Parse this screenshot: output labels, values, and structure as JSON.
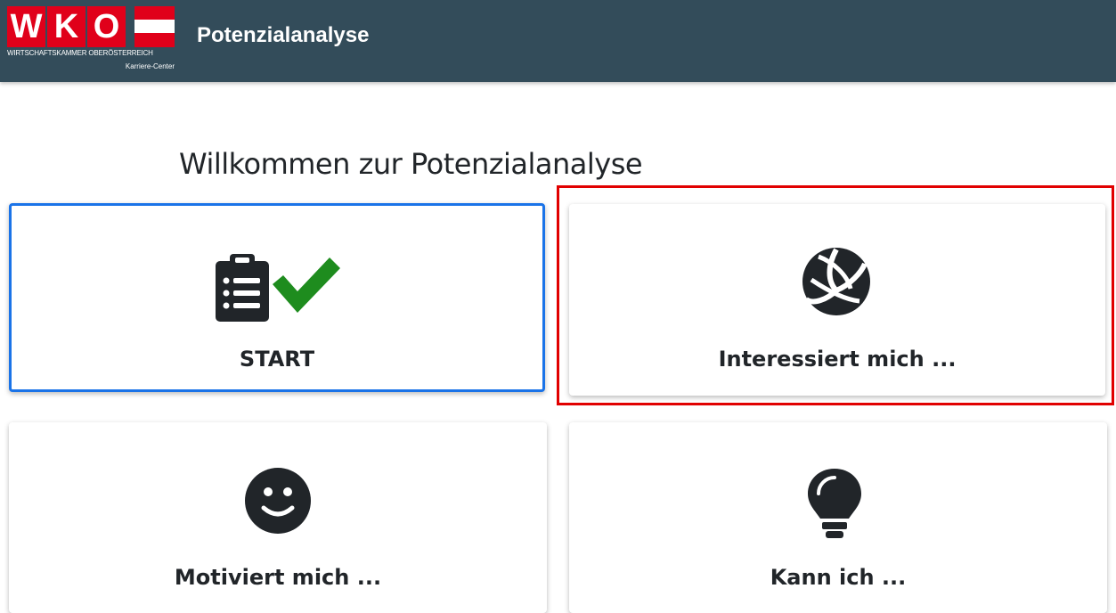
{
  "header": {
    "logo_letters": [
      "W",
      "K",
      "O"
    ],
    "logo_subtitle": "WIRTSCHAFTSKAMMER OBERÖSTERREICH",
    "logo_subtitle2": "Karriere-Center",
    "title": "Potenzialanalyse"
  },
  "main": {
    "heading": "Willkommen zur Potenzialanalyse",
    "tiles": [
      {
        "label": "START",
        "icon": "clipboard-check-icon"
      },
      {
        "label": "Interessiert mich ...",
        "icon": "volleyball-icon"
      },
      {
        "label": "Motiviert mich ...",
        "icon": "smiley-icon"
      },
      {
        "label": "Kann ich ...",
        "icon": "lightbulb-icon"
      }
    ]
  },
  "colors": {
    "header_bg": "#334c5a",
    "logo_red": "#e0001a",
    "selected_border": "#1a73e8",
    "highlight_border": "#e10000",
    "check_green": "#1e8c1e"
  }
}
